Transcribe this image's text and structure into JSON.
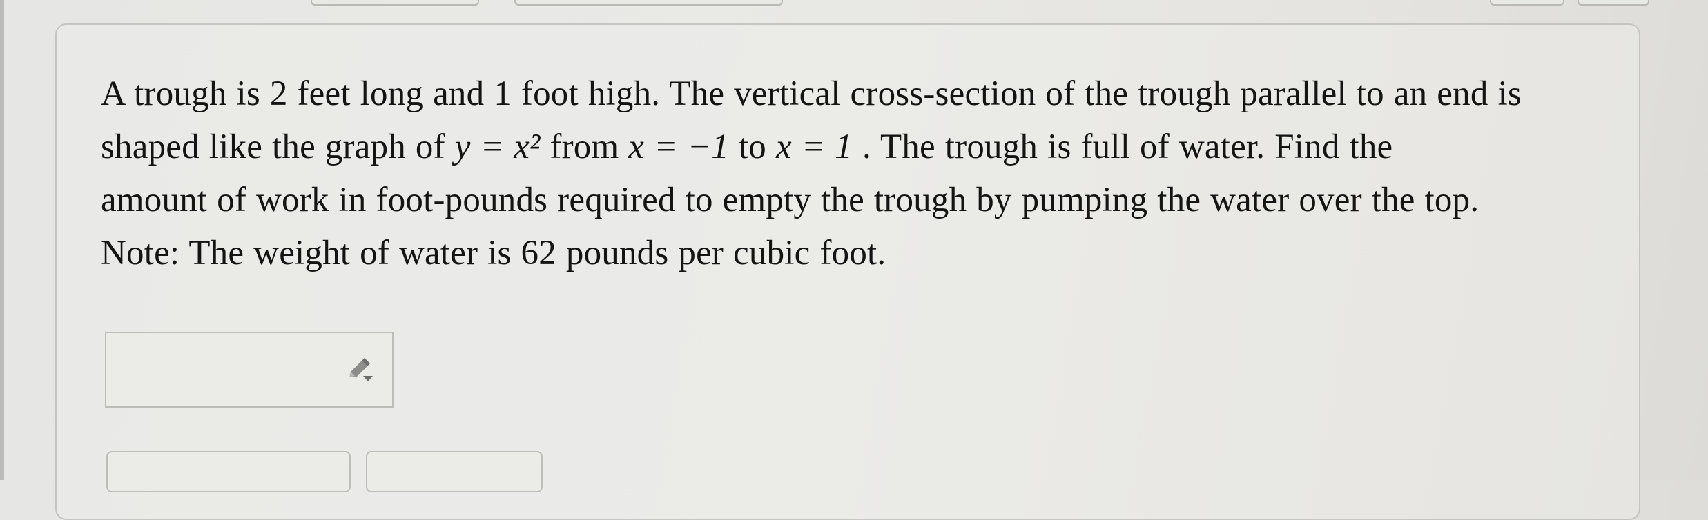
{
  "question": {
    "line1": "A trough is 2 feet long and 1 foot high. The vertical cross-section of the trough parallel to an end is",
    "line2_a": "shaped like the graph of ",
    "line2_math1": "y = x²",
    "line2_b": " from ",
    "line2_math2": "x = −1",
    "line2_c": " to ",
    "line2_math3": "x = 1",
    "line2_d": " . The trough is full of water. Find the",
    "line3": "amount of work in foot-pounds required to empty the trough by pumping the water over the top.",
    "line4": "Note: The weight of water is 62 pounds per cubic foot."
  },
  "answer": {
    "value": "",
    "tool_icon": "pencil-icon"
  },
  "buttons": {
    "submit_label": "",
    "next_label": ""
  }
}
